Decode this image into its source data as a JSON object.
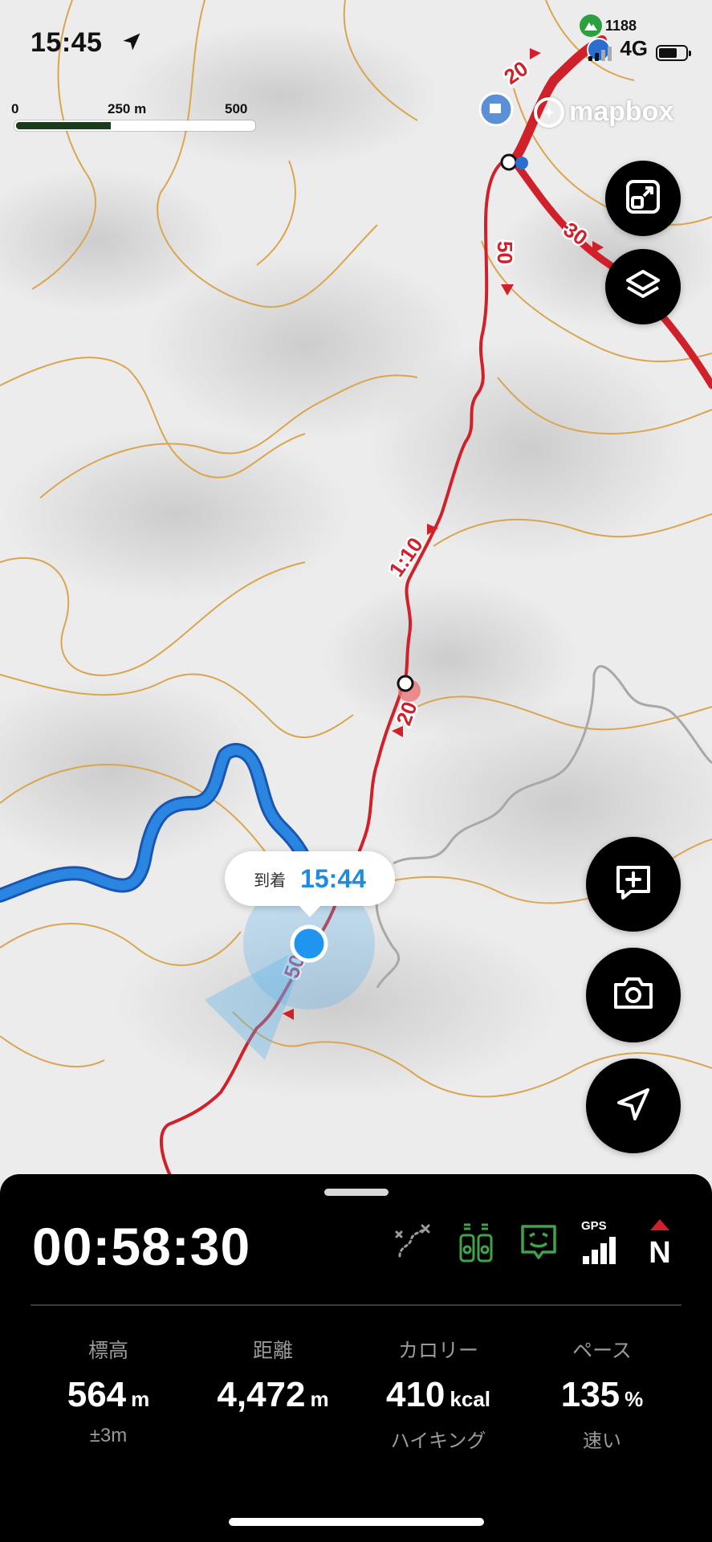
{
  "status": {
    "time": "15:45",
    "network": "4G",
    "peak_count": "1188"
  },
  "scale": {
    "labels": [
      "0",
      "250 m",
      "500 m"
    ]
  },
  "map": {
    "attribution": "mapbox",
    "route_labels": [
      "20",
      "30",
      "50",
      "1:10",
      "20",
      "50"
    ]
  },
  "arrival": {
    "label": "到着",
    "time": "15:44"
  },
  "panel": {
    "elapsed": "00:58:30",
    "gps_label": "GPS",
    "compass_label": "N",
    "stats": [
      {
        "label": "標高",
        "value": "564",
        "unit": "m",
        "sub": "±3m"
      },
      {
        "label": "距離",
        "value": "4,472",
        "unit": "m",
        "sub": ""
      },
      {
        "label": "カロリー",
        "value": "410",
        "unit": "kcal",
        "sub": "ハイキング"
      },
      {
        "label": "ペース",
        "value": "135",
        "unit": "%",
        "sub": "速い"
      }
    ]
  },
  "colors": {
    "route": "#d0202a",
    "river": "#2a86e0",
    "contour": "#d9a650",
    "location": "#1f95f0",
    "active_icon": "#3ea34a"
  },
  "icons": [
    "location-arrow-icon",
    "mapbox-logo-icon",
    "expand-icon",
    "layers-icon",
    "add-note-icon",
    "camera-icon",
    "navigate-icon",
    "route-off-icon",
    "water-bottles-icon",
    "chat-icon",
    "gps-signal-icon",
    "compass-north-icon"
  ]
}
